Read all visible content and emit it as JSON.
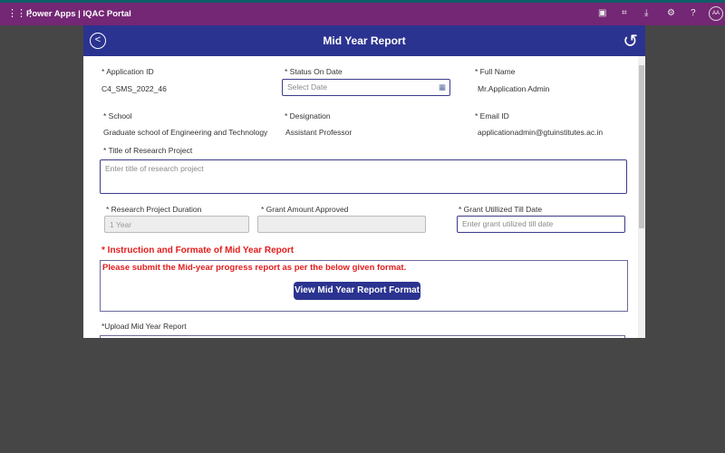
{
  "appbar": {
    "title": "Power Apps  |  IQAC Portal",
    "avatar": "AA",
    "icons": [
      "waffle-icon",
      "teams-icon",
      "fit-screen-icon",
      "download-icon",
      "settings-icon",
      "help-icon"
    ]
  },
  "header": {
    "title": "Mid Year Report"
  },
  "form": {
    "application_id_label": "* Application ID",
    "application_id": "C4_SMS_2022_46",
    "status_date_label": "* Status On Date",
    "status_date_placeholder": "Select Date",
    "full_name_label": "* Full Name",
    "full_name": "Mr.Application Admin",
    "school_label": "* School",
    "school": "Graduate school of Engineering and Technology",
    "designation_label": "* Designation",
    "designation": "Assistant Professor",
    "email_label": "* Email ID",
    "email": "applicationadmin@gtuinstitutes.ac.in",
    "title_label": "* Title of Research Project",
    "title_placeholder": "Enter title of research project",
    "duration_label": "* Research Project Duration",
    "duration": "1 Year",
    "grant_label": "* Grant Amount Approved",
    "grant": "",
    "utilized_label": "* Grant Utillized Till Date",
    "utilized_placeholder": "Enter grant utilized till date",
    "instruction_heading": "* Instruction and Formate of  Mid Year Report",
    "instruction_text": "Please submit the Mid-year progress report as per the below given format.",
    "view_format_button": "View Mid Year Report Format",
    "upload_label": "*Upload Mid Year Report"
  }
}
